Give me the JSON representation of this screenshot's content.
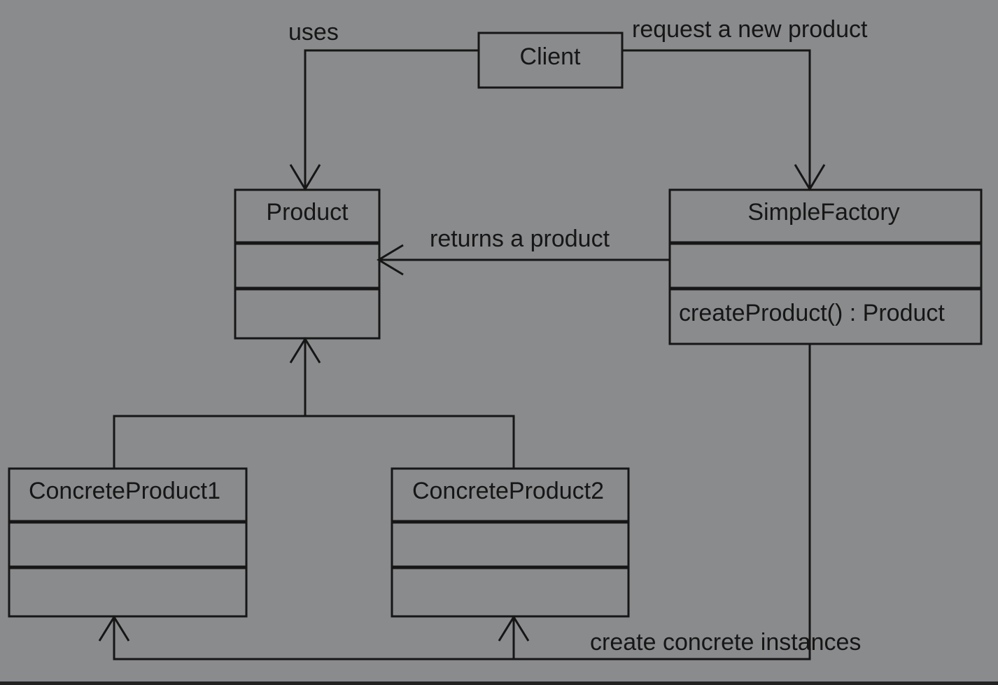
{
  "diagram": {
    "classes": {
      "client": "Client",
      "product": "Product",
      "simple_factory": "SimpleFactory",
      "simple_factory_method": "createProduct() : Product",
      "concrete_product_1": "ConcreteProduct1",
      "concrete_product_2": "ConcreteProduct2"
    },
    "relations": {
      "uses": "uses",
      "request": "request a new product",
      "returns": "returns a product",
      "creates": "create concrete instances"
    },
    "colors": {
      "background": "#8a8b8d",
      "stroke": "#161616"
    }
  }
}
